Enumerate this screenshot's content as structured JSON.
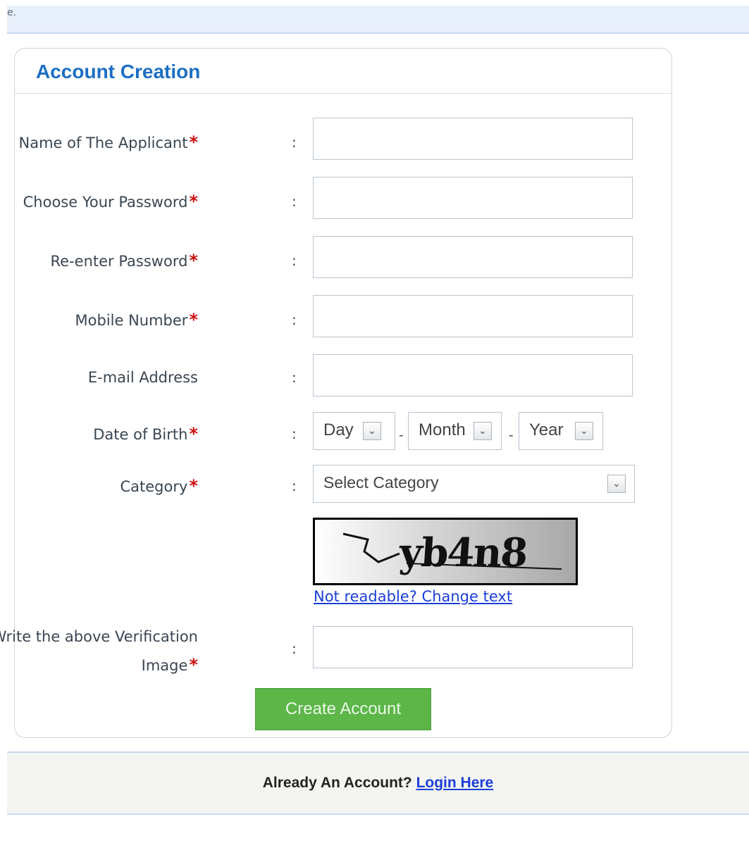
{
  "topbar": {
    "text": "e."
  },
  "panel": {
    "title": "Account Creation"
  },
  "form": {
    "colon": ":",
    "required_mark": "*",
    "name_label": "Name of The Applicant",
    "password_label": "Choose Your Password",
    "reenter_label": "Re-enter Password",
    "mobile_label": "Mobile Number",
    "email_label": "E-mail Address",
    "dob_label": "Date of Birth",
    "category_label": "Category",
    "verification_label_line1": "Write the above Verification",
    "verification_label_line2": "Image",
    "name_value": "",
    "password_value": "",
    "reenter_value": "",
    "mobile_value": "",
    "email_value": "",
    "verification_value": "",
    "dob_day": "Day",
    "dob_month": "Month",
    "dob_year": "Year",
    "dob_separator": "-",
    "category_selected": "Select Category",
    "captcha_text": "yb4n8",
    "change_captcha_link": "Not readable? Change text",
    "create_button": "Create Account"
  },
  "footer": {
    "question": "Already An Account?",
    "login_link": "Login Here"
  },
  "icons": {
    "dropdown": "chevron-down-icon"
  },
  "colors": {
    "title": "#1d6fc3",
    "required": "#cc1010",
    "button": "#5cb648",
    "link": "#1a3fd8"
  }
}
